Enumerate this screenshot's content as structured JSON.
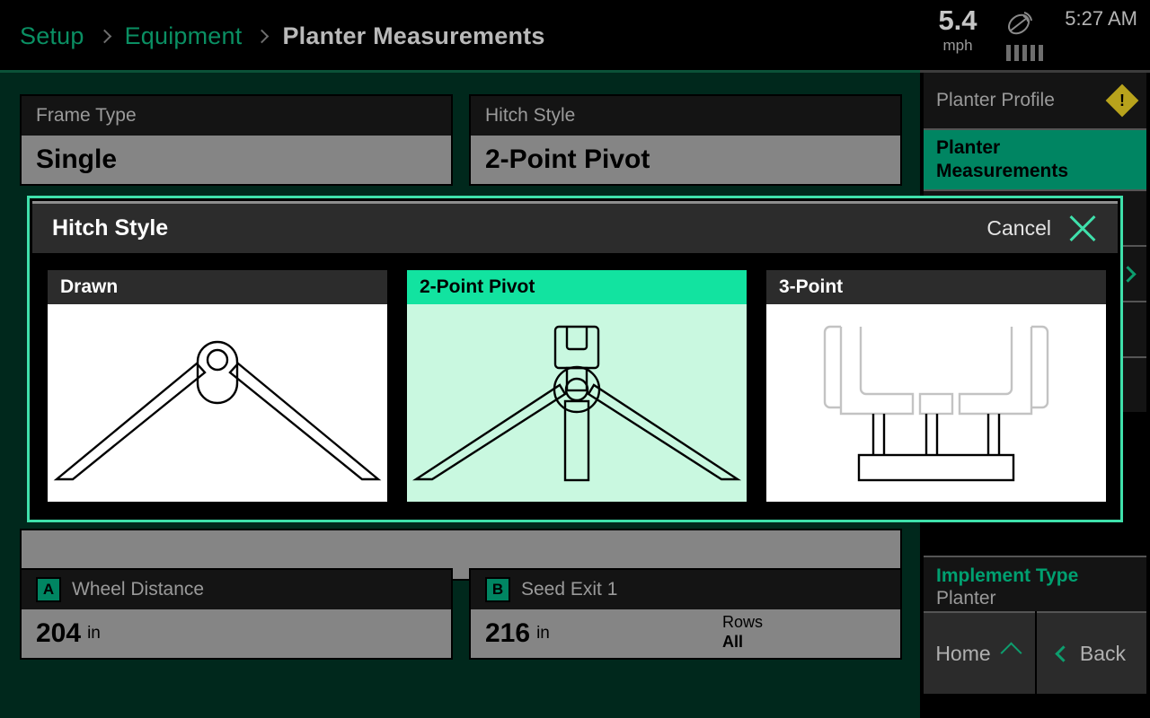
{
  "header": {
    "breadcrumb": [
      {
        "label": "Setup",
        "active": false
      },
      {
        "label": "Equipment",
        "active": false
      },
      {
        "label": "Planter Measurements",
        "active": true
      }
    ],
    "speed_value": "5.4",
    "speed_unit": "mph",
    "gps_icon": "satellite-dish-icon",
    "signal_bars": 5,
    "clock": "5:27 AM"
  },
  "fields": {
    "frame_type": {
      "label": "Frame Type",
      "value": "Single"
    },
    "hitch_style": {
      "label": "Hitch Style",
      "value": "2-Point Pivot"
    },
    "wheel_distance": {
      "badge": "A",
      "label": "Wheel Distance",
      "value": "204",
      "unit": "in"
    },
    "seed_exit": {
      "badge": "B",
      "label": "Seed Exit 1",
      "value": "216",
      "unit": "in",
      "rows_label": "Rows",
      "rows_value": "All"
    }
  },
  "sidebar": {
    "items": [
      {
        "label": "Planter Profile",
        "active": false,
        "warning": true
      },
      {
        "label": "Planter Measurements",
        "active": true,
        "warning": false
      }
    ],
    "implement": {
      "label": "Implement Type",
      "value": "Planter"
    },
    "home_label": "Home",
    "back_label": "Back"
  },
  "dialog": {
    "title": "Hitch Style",
    "cancel_label": "Cancel",
    "close_icon": "close-icon",
    "options": [
      {
        "label": "Drawn",
        "selected": false,
        "illustration": "drawn-hitch-illustration"
      },
      {
        "label": "2-Point Pivot",
        "selected": true,
        "illustration": "two-point-pivot-illustration"
      },
      {
        "label": "3-Point",
        "selected": false,
        "illustration": "three-point-hitch-illustration"
      }
    ]
  },
  "colors": {
    "background": "#00281c",
    "accent_green": "#12e3a0",
    "sidebar_active": "#008562",
    "warning_yellow": "#b8a31c",
    "field_value_bg": "#858585"
  }
}
